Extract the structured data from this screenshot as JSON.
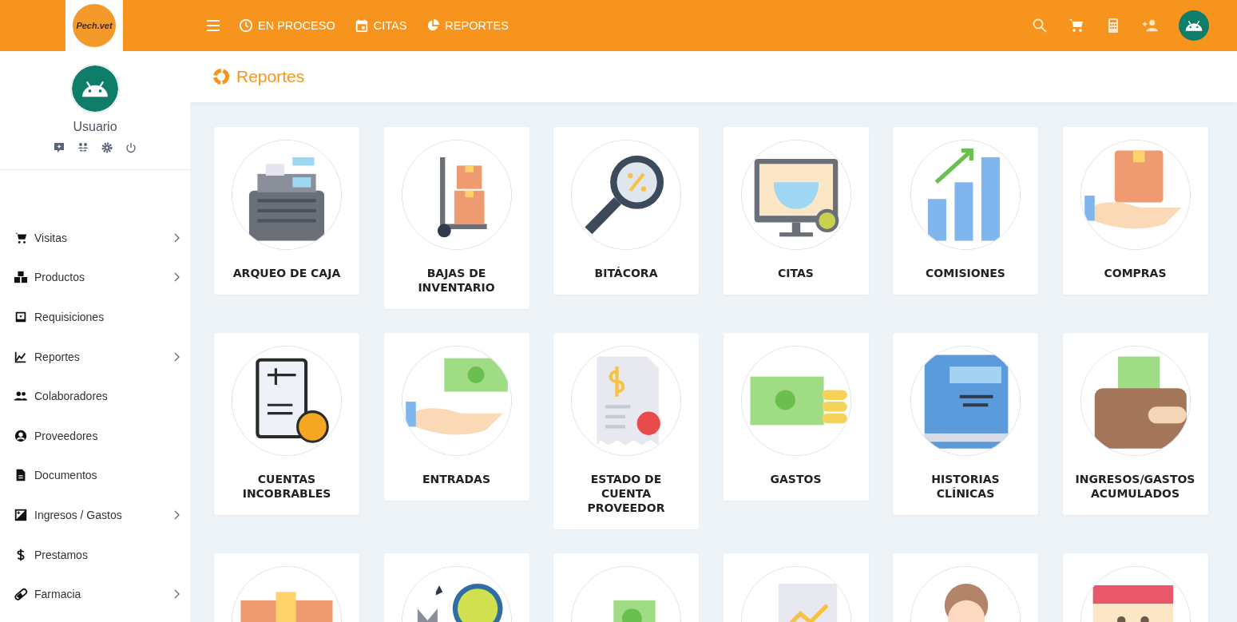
{
  "topbar": {
    "logo_text": "Pech.vet",
    "nav": [
      {
        "label": "EN PROCESO",
        "kind": "clock"
      },
      {
        "label": "CITAS",
        "kind": "calendar"
      },
      {
        "label": "REPORTES",
        "kind": "pie"
      }
    ]
  },
  "user": {
    "name": "Usuario"
  },
  "sidebar": {
    "items": [
      {
        "label": "Visitas",
        "kind": "cart",
        "has_submenu": true
      },
      {
        "label": "Productos",
        "kind": "boxes",
        "has_submenu": true
      },
      {
        "label": "Requisiciones",
        "kind": "inbox",
        "has_submenu": false
      },
      {
        "label": "Reportes",
        "kind": "chart",
        "has_submenu": true
      },
      {
        "label": "Colaboradores",
        "kind": "people",
        "has_submenu": false
      },
      {
        "label": "Proveedores",
        "kind": "person",
        "has_submenu": false
      },
      {
        "label": "Documentos",
        "kind": "doc",
        "has_submenu": false
      },
      {
        "label": "Ingresos / Gastos",
        "kind": "diff",
        "has_submenu": true
      },
      {
        "label": "Prestamos",
        "kind": "dollar",
        "has_submenu": false
      },
      {
        "label": "Farmacia",
        "kind": "pill",
        "has_submenu": true
      }
    ]
  },
  "page": {
    "title": "Reportes"
  },
  "reports": [
    {
      "kind": "labeled",
      "label": "ARQUEO DE CAJA"
    },
    {
      "kind": "labeled",
      "label": "BAJAS DE INVENTARIO"
    },
    {
      "kind": "labeled",
      "label": "BITÁCORA"
    },
    {
      "kind": "labeled",
      "label": "CITAS"
    },
    {
      "kind": "labeled",
      "label": "COMISIONES"
    },
    {
      "kind": "labeled",
      "label": "COMPRAS"
    },
    {
      "kind": "labeled",
      "label": "CUENTAS INCOBRABLES"
    },
    {
      "kind": "labeled",
      "label": "ENTRADAS"
    },
    {
      "kind": "labeled",
      "label": "ESTADO DE CUENTA PROVEEDOR"
    },
    {
      "kind": "labeled",
      "label": "GASTOS"
    },
    {
      "kind": "labeled",
      "label": "HISTORIAS CLÍNICAS"
    },
    {
      "kind": "labeled",
      "label": "INGRESOS/GASTOS ACUMULADOS"
    },
    {
      "kind": "partial"
    },
    {
      "kind": "partial"
    },
    {
      "kind": "partial"
    },
    {
      "kind": "partial"
    },
    {
      "kind": "partial"
    },
    {
      "kind": "partial"
    }
  ]
}
